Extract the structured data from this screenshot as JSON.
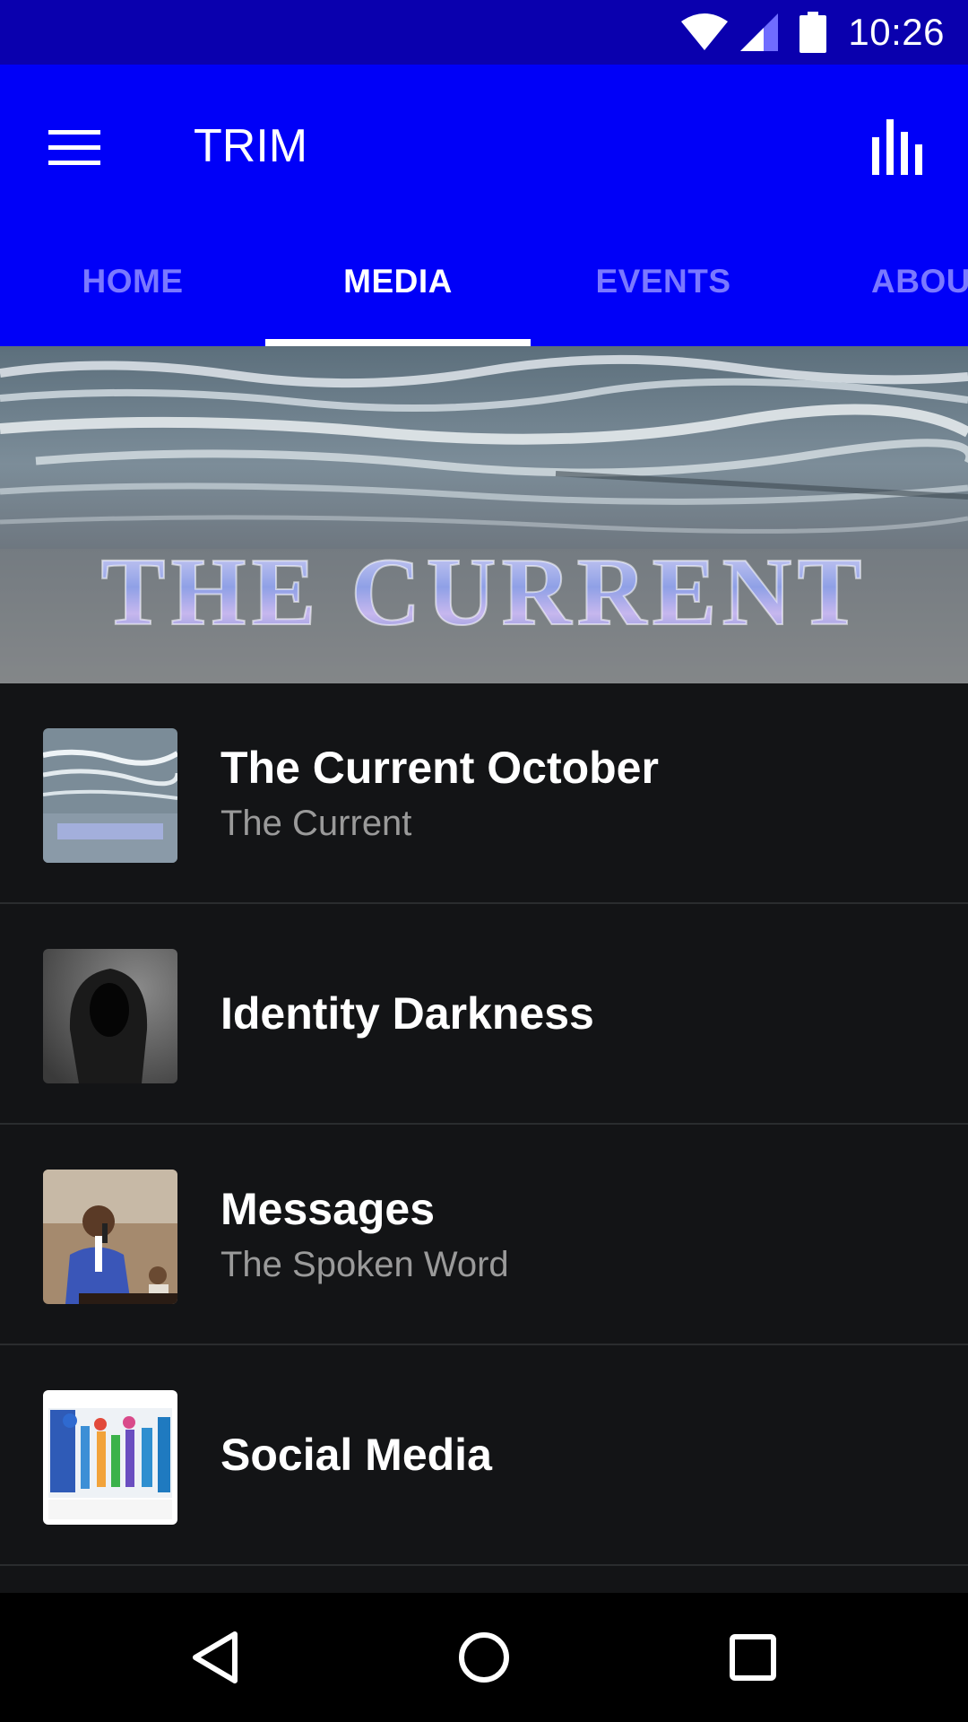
{
  "status_bar": {
    "time": "10:26",
    "icons": [
      "wifi-icon",
      "cell-signal-icon",
      "battery-icon"
    ]
  },
  "app_bar": {
    "title": "TRIM",
    "color": "#0000f8",
    "menu_icon": "hamburger-menu-icon",
    "action_icon": "bar-chart-icon"
  },
  "tabs": [
    {
      "label": "HOME",
      "active": false
    },
    {
      "label": "MEDIA",
      "active": true
    },
    {
      "label": "EVENTS",
      "active": false
    },
    {
      "label": "ABOUT",
      "active": false
    }
  ],
  "banner": {
    "text": "THE CURRENT"
  },
  "media_items": [
    {
      "title": "The Current October",
      "subtitle": "The Current",
      "thumb": "ocean-waves-thumbnail"
    },
    {
      "title": "Identity Darkness",
      "subtitle": "",
      "thumb": "hooded-figure-thumbnail"
    },
    {
      "title": "Messages",
      "subtitle": "The Spoken Word",
      "thumb": "preacher-thumbnail"
    },
    {
      "title": "Social Media",
      "subtitle": "",
      "thumb": "social-media-people-thumbnail"
    }
  ],
  "nav_bar": {
    "icons": [
      "back-icon",
      "home-icon",
      "recents-icon"
    ]
  }
}
